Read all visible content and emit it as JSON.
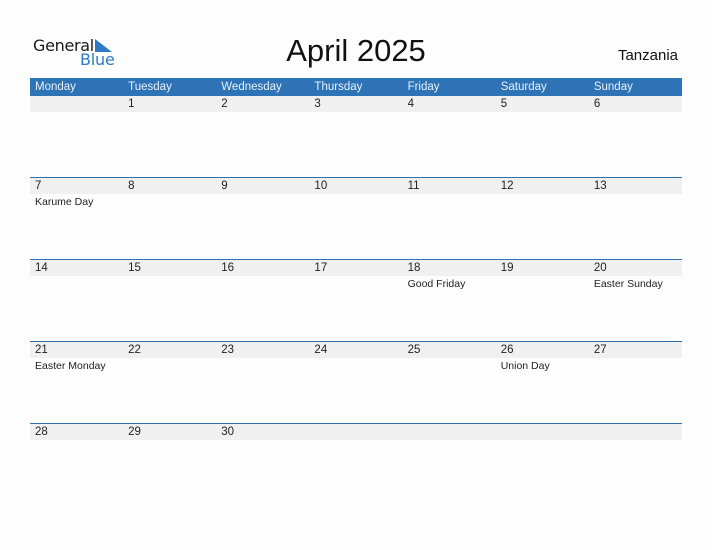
{
  "logo": {
    "line1": "General",
    "line2": "Blue"
  },
  "title": "April 2025",
  "country": "Tanzania",
  "colors": {
    "header_bg": "#2e73b5",
    "accent": "#2e7bc4",
    "date_row_bg": "#f0f0f0"
  },
  "weekdays": [
    "Monday",
    "Tuesday",
    "Wednesday",
    "Thursday",
    "Friday",
    "Saturday",
    "Sunday"
  ],
  "weeks": [
    {
      "days": [
        "",
        "1",
        "2",
        "3",
        "4",
        "5",
        "6"
      ],
      "events": [
        "",
        "",
        "",
        "",
        "",
        "",
        ""
      ]
    },
    {
      "days": [
        "7",
        "8",
        "9",
        "10",
        "11",
        "12",
        "13"
      ],
      "events": [
        "Karume Day",
        "",
        "",
        "",
        "",
        "",
        ""
      ]
    },
    {
      "days": [
        "14",
        "15",
        "16",
        "17",
        "18",
        "19",
        "20"
      ],
      "events": [
        "",
        "",
        "",
        "",
        "Good Friday",
        "",
        "Easter Sunday"
      ]
    },
    {
      "days": [
        "21",
        "22",
        "23",
        "24",
        "25",
        "26",
        "27"
      ],
      "events": [
        "Easter Monday",
        "",
        "",
        "",
        "",
        "Union Day",
        ""
      ]
    },
    {
      "days": [
        "28",
        "29",
        "30",
        "",
        "",
        "",
        ""
      ],
      "events": [
        "",
        "",
        "",
        "",
        "",
        "",
        ""
      ]
    }
  ]
}
